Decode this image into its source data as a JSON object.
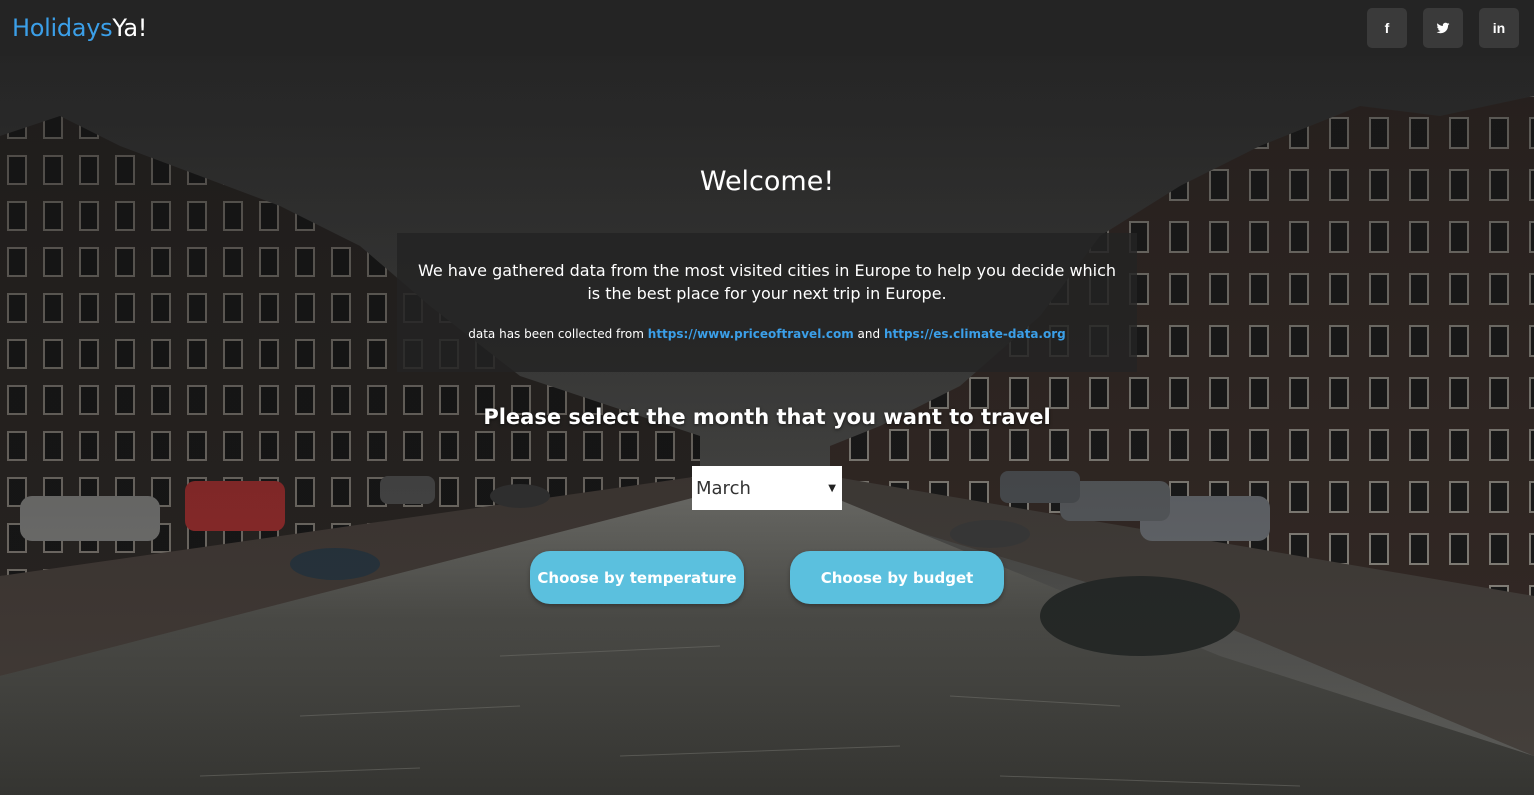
{
  "navbar": {
    "brand_part1": "Holidays",
    "brand_part2": "Ya!",
    "social": [
      {
        "name": "facebook-icon",
        "glyph": "f"
      },
      {
        "name": "twitter-icon",
        "glyph": "twitter-bird"
      },
      {
        "name": "linkedin-icon",
        "glyph": "in"
      }
    ]
  },
  "hero": {
    "welcome": "Welcome!",
    "info_text": "We have gathered data from the most visited cities in Europe to help you decide which is the best place for your next trip in Europe.",
    "source_prefix": "data has been collected from ",
    "source_link1": "https://www.priceoftravel.com",
    "source_and": " and ",
    "source_link2": "https://es.climate-data.org",
    "prompt": "Please select the month that you want to travel",
    "month_selected": "March",
    "btn_temperature": "Choose by temperature",
    "btn_budget": "Choose by budget"
  },
  "colors": {
    "brand_accent": "#3b9fe8",
    "button_bg": "#5bc0de",
    "navbar_bg": "#242424"
  }
}
